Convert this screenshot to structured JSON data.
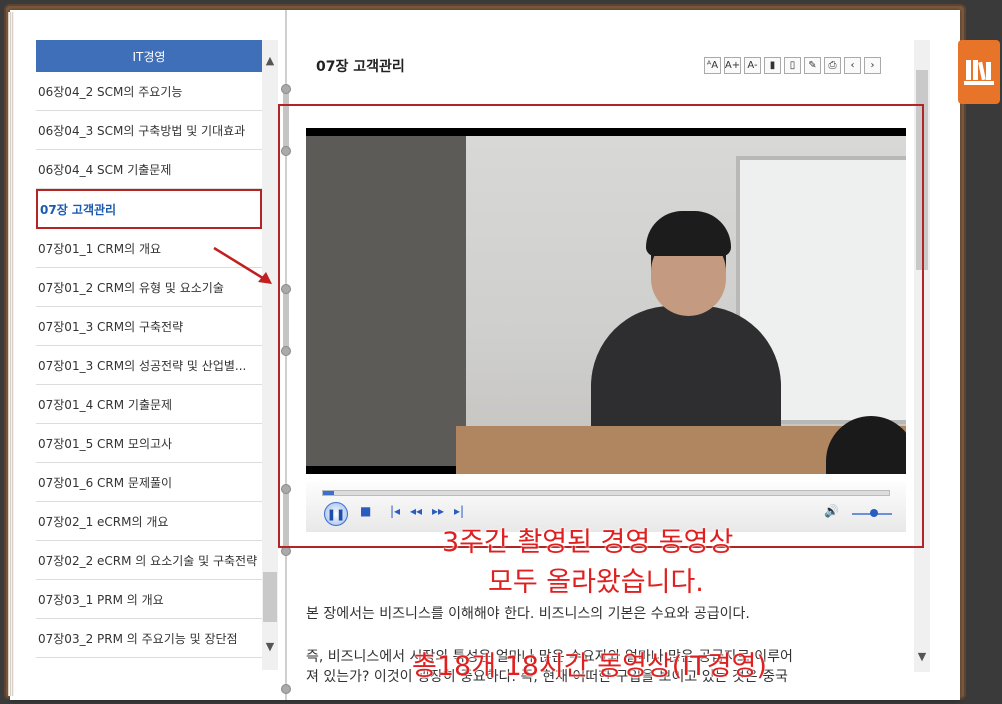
{
  "toc": {
    "header": "IT경영",
    "items": [
      {
        "label": "06장04_2 SCM의 주요기능",
        "active": false
      },
      {
        "label": "06장04_3 SCM의 구축방법 및 기대효과",
        "active": false
      },
      {
        "label": "06장04_4 SCM 기출문제",
        "active": false
      },
      {
        "label": "07장 고객관리",
        "active": true
      },
      {
        "label": "07장01_1 CRM의 개요",
        "active": false
      },
      {
        "label": "07장01_2 CRM의 유형 및 요소기술",
        "active": false
      },
      {
        "label": "07장01_3 CRM의 구축전략",
        "active": false
      },
      {
        "label": "07장01_3 CRM의 성공전략 및 산업별...",
        "active": false
      },
      {
        "label": "07장01_4 CRM 기출문제",
        "active": false
      },
      {
        "label": "07장01_5 CRM 모의고사",
        "active": false
      },
      {
        "label": "07장01_6 CRM 문제풀이",
        "active": false
      },
      {
        "label": "07장02_1 eCRM의 개요",
        "active": false
      },
      {
        "label": "07장02_2 eCRM 의 요소기술 및 구축전략",
        "active": false
      },
      {
        "label": "07장03_1 PRM 의 개요",
        "active": false
      },
      {
        "label": "07장03_2 PRM 의 주요기능 및 장단점",
        "active": false
      }
    ]
  },
  "content": {
    "chapter_title": "07장 고객관리",
    "toolbar": [
      "ᴬA",
      "A+",
      "A-",
      "bookmark",
      "bookmark-list",
      "memo",
      "print",
      "‹",
      "›"
    ],
    "paragraph1": "본 장에서는 비즈니스를 이해해야 한다. 비즈니스의 기본은 수요와 공급이다.",
    "paragraph2": "즉, 비즈니스에서 시장의 특성은 얼마나 많은 수요자와 얼마나 많은 공급자로 이루어",
    "paragraph3": "져 있는가? 이것이 굉장히 중요하다. 즉, 현재 어떠한 구입을 보이고 있는 것은 중국"
  },
  "overlay": {
    "line1": "3주간 촬영된 경영 동영상",
    "line2": "모두 올라왔습니다.",
    "line3": "총18개 18시간 동영상(IT경영)"
  },
  "player": {
    "progress": 0.02,
    "volume": 0.5
  },
  "colors": {
    "toc_header": "#3f6fb8",
    "highlight_border": "#b52424",
    "overlay_text": "#e02020",
    "shelf_button": "#e8742a"
  }
}
